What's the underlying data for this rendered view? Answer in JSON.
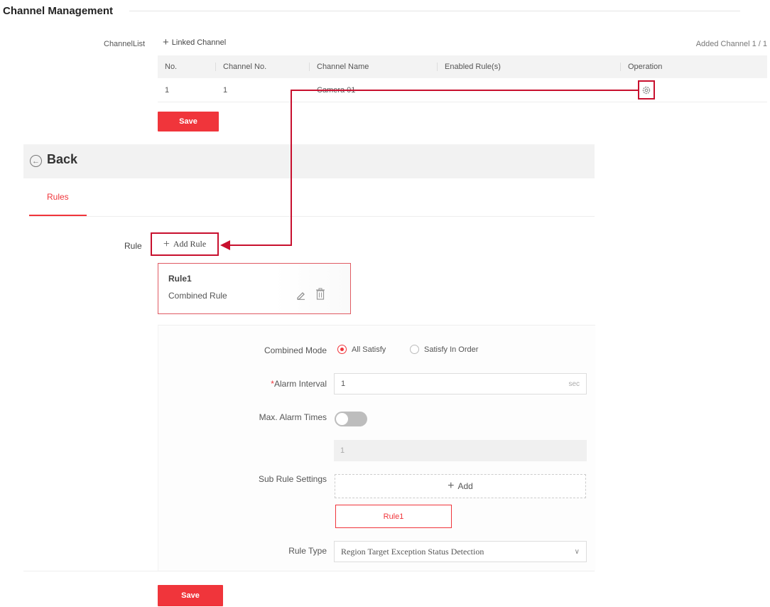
{
  "header": {
    "title": "Channel Management"
  },
  "channel_list": {
    "label": "ChannelList",
    "linked_channel_label": "Linked Channel",
    "added_count": "Added Channel 1 / 1",
    "columns": [
      "No.",
      "Channel No.",
      "Channel Name",
      "Enabled Rule(s)",
      "Operation"
    ],
    "rows": [
      {
        "no": "1",
        "channel_no": "1",
        "channel_name": "Camera 01",
        "enabled_rules": ""
      }
    ]
  },
  "save_label": "Save",
  "back_label": "Back",
  "tabs": [
    {
      "label": "Rules",
      "active": true
    }
  ],
  "rule_section": {
    "label": "Rule",
    "add_rule_label": "Add Rule",
    "card": {
      "title": "Rule1",
      "subtitle": "Combined Rule"
    }
  },
  "form": {
    "combined_mode": {
      "label": "Combined Mode",
      "options": [
        "All Satisfy",
        "Satisfy In Order"
      ],
      "selected": "All Satisfy"
    },
    "alarm_interval": {
      "label": "Alarm Interval",
      "required_mark": "*",
      "value": "1",
      "unit": "sec"
    },
    "max_alarm_times": {
      "label": "Max. Alarm Times",
      "enabled": false,
      "value": "1"
    },
    "sub_rule_settings": {
      "label": "Sub Rule Settings",
      "add_label": "Add",
      "items": [
        "Rule1"
      ]
    },
    "rule_type": {
      "label": "Rule Type",
      "value": "Region Target Exception Status Detection"
    }
  },
  "colors": {
    "accent": "#f0353b",
    "annotation": "#c8102e"
  },
  "icons": [
    "plus-icon",
    "gear-icon",
    "back-arrow-icon",
    "edit-icon",
    "trash-icon",
    "chevron-down-icon"
  ]
}
